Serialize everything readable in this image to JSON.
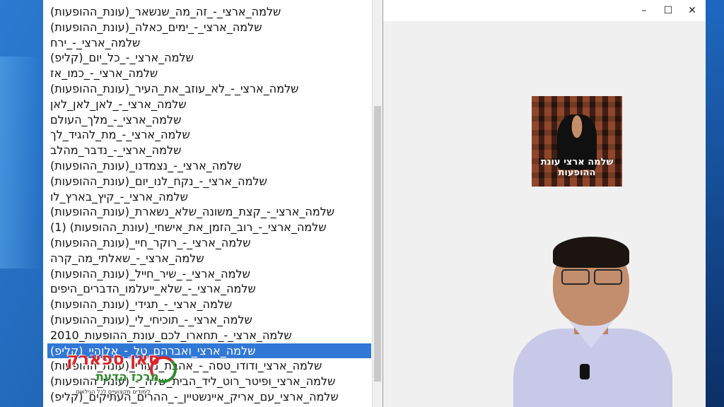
{
  "window": {
    "controls": {
      "minimize": "–",
      "maximize": "☐",
      "close": "✕"
    }
  },
  "playlist": {
    "items": [
      "שלמה_ארצי_-_זה_מה_שנשאר_(עונת_ההופעות)",
      "שלמה_ארצי_-_ימים_כאלה_(עונת_ההופעות)",
      "שלמה_ארצי_-_ירח",
      "שלמה_ארצי_-_כל_יום_(קליפ)",
      "שלמה_ארצי_-_כמו_אז",
      "שלמה_ארצי_-_לא_עוזב_את_העיר_(עונת_ההופעות)",
      "שלמה_ארצי_-_לאן_לאן_לאן",
      "שלמה_ארצי_-_מלך_העולם",
      "שלמה_ארצי_-_מת_להגיד_לך",
      "שלמה_ארצי_-_נדבר_מהלב",
      "שלמה_ארצי_-_נצמדנו_(עונת_ההופעות)",
      "שלמה_ארצי_-_נקח_לנו_יום_(עונת_ההופעות)",
      "שלמה_ארצי_-_קיץ_בארץ_לו",
      "שלמה_ארצי_-_קצת_משונה_שלא_נשארת_(עונת_ההופעות)",
      "שלמה_ארצי_-_רוב_הזמן_את_אישחי_(עונת_ההופעות) (1)",
      "שלמה_ארצי_-_רוקר_חיי_(עונת_ההופעות)",
      "שלמה_ארצי_-_שאלתי_מה_קרה",
      "שלמה_ארצי_-_שיר_חייל_(עונת_ההופעות)",
      "שלמה_ארצי_-_שלא_ייעלמו_הדברים_היפים",
      "שלמה_ארצי_-_תגידי_(עונת_ההופעות)",
      "שלמה_ארצי_-_תוכיחי_לי_(עונת_ההופעות)",
      "שלמה_ארצי_-_תחארו_לכם_עונת_ההופעות_2010",
      "שלמה_ארצי_ואברהם_טל_-_אלוהיי_(קליפ)",
      "שלמה_ארצי_ודודו_טסה_-_אהבת_נעורי_(עונת_ההופעות)",
      "שלמה_ארצי_ופיטר_רוט_ליד_הבית_שלה_-_(עונת_ההופעות)",
      "שלמה_ארצי_עם_אריק_איינשטיין_-_ההרים_העתיקים_(קליפ)"
    ],
    "selected_index": 22
  },
  "album": {
    "title": "שלמה ארצי עונת ההופעות"
  },
  "logo": {
    "line1": "סאן ספארק",
    "line2": "מרכז הדעת",
    "tagline": "לימודים מקצועיים לכל הגילאים"
  }
}
